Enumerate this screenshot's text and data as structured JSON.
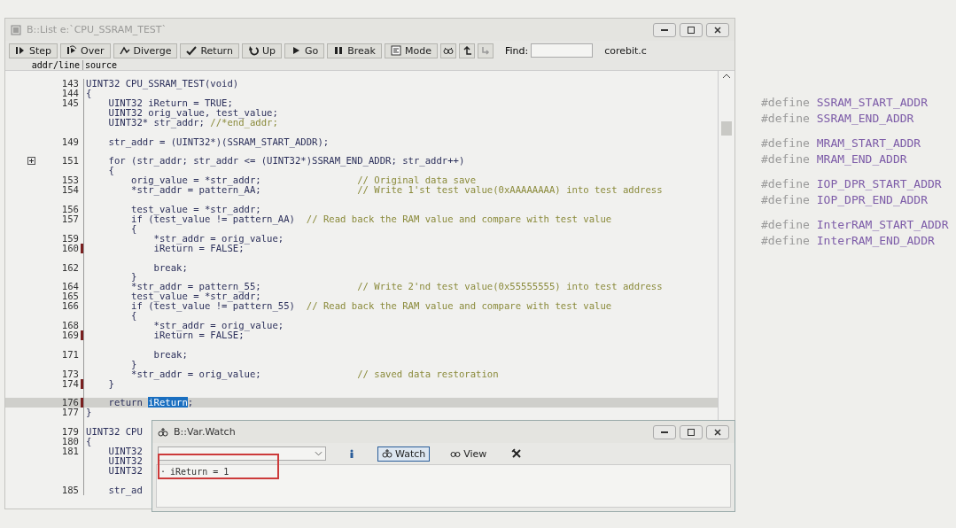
{
  "list_window": {
    "title": "B::List e:`CPU_SSRAM_TEST`",
    "toolbar": [
      {
        "kind": "step",
        "label": "Step"
      },
      {
        "kind": "over",
        "label": "Over"
      },
      {
        "kind": "diverge",
        "label": "Diverge"
      },
      {
        "kind": "return",
        "label": "Return"
      },
      {
        "kind": "up",
        "label": "Up"
      },
      {
        "kind": "go",
        "label": "Go"
      },
      {
        "kind": "break",
        "label": "Break"
      },
      {
        "kind": "mode",
        "label": "Mode"
      },
      {
        "kind": "glasses"
      },
      {
        "kind": "back"
      },
      {
        "kind": "forward"
      }
    ],
    "find": {
      "label": "Find:"
    },
    "file": "corebit.c",
    "columns": [
      "addr/line",
      "source"
    ],
    "rows": [
      {
        "line": "143",
        "code": "UINT32 CPU_SSRAM_TEST(void)",
        "marked": false,
        "current": false
      },
      {
        "line": "144",
        "code": "{",
        "marked": false,
        "current": false
      },
      {
        "line": "145",
        "code": "    UINT32 iReturn = TRUE;",
        "marked": false,
        "current": false
      },
      {
        "code": "    UINT32 orig_value, test_value;",
        "marked": false,
        "current": false
      },
      {
        "code": "    UINT32* str_addr;",
        "end_comment": "//*end_addr;",
        "marked": false,
        "current": false
      },
      {
        "marked": false,
        "current": false
      },
      {
        "line": "149",
        "code": "    str_addr = (UINT32*)(SSRAM_START_ADDR);",
        "marked": false,
        "current": false
      },
      {
        "marked": false,
        "current": false
      },
      {
        "line": "151",
        "code": "    for (str_addr; str_addr <= (UINT32*)SSRAM_END_ADDR; str_addr++)",
        "expandable": true,
        "marked": false,
        "current": false
      },
      {
        "code": "    {",
        "marked": false,
        "current": false
      },
      {
        "line": "153",
        "code": "        orig_value = *str_addr;",
        "comment": "// Original data save",
        "marked": false,
        "current": false
      },
      {
        "line": "154",
        "code": "        *str_addr = pattern_AA;",
        "comment": "// Write 1'st test value(0xAAAAAAAA) into test address",
        "marked": false,
        "current": false
      },
      {
        "marked": false,
        "current": false
      },
      {
        "line": "156",
        "code": "        test_value = *str_addr;",
        "marked": false,
        "current": false
      },
      {
        "line": "157",
        "code": "        if (test_value != pattern_AA)",
        "inline_comment": "// Read back the RAM value and compare with test value",
        "marked": false,
        "current": false
      },
      {
        "code": "        {",
        "marked": false,
        "current": false
      },
      {
        "line": "159",
        "code": "            *str_addr = orig_value;",
        "marked": false,
        "current": false
      },
      {
        "line": "160",
        "code": "            iReturn = FALSE;",
        "marked": true,
        "current": false
      },
      {
        "marked": false,
        "current": false
      },
      {
        "line": "162",
        "code": "            break;",
        "marked": false,
        "current": false
      },
      {
        "code": "        }",
        "marked": false,
        "current": false
      },
      {
        "line": "164",
        "code": "        *str_addr = pattern_55;",
        "comment": "// Write 2'nd test value(0x55555555) into test address",
        "marked": false,
        "current": false
      },
      {
        "line": "165",
        "code": "        test_value = *str_addr;",
        "marked": false,
        "current": false
      },
      {
        "line": "166",
        "code": "        if (test_value != pattern_55)",
        "inline_comment": "// Read back the RAM value and compare with test value",
        "marked": false,
        "current": false
      },
      {
        "code": "        {",
        "marked": false,
        "current": false
      },
      {
        "line": "168",
        "code": "            *str_addr = orig_value;",
        "marked": false,
        "current": false
      },
      {
        "line": "169",
        "code": "            iReturn = FALSE;",
        "marked": true,
        "current": false
      },
      {
        "marked": false,
        "current": false
      },
      {
        "line": "171",
        "code": "            break;",
        "marked": false,
        "current": false
      },
      {
        "code": "        }",
        "marked": false,
        "current": false
      },
      {
        "line": "173",
        "code": "        *str_addr = orig_value;",
        "comment": "// saved data restoration",
        "marked": false,
        "current": false
      },
      {
        "line": "174",
        "code": "    }",
        "marked": true,
        "current": false
      },
      {
        "marked": false,
        "current": false
      },
      {
        "line": "176",
        "code": "    return",
        "selection": "iReturn",
        "code_end": ";",
        "marked": true,
        "current": true
      },
      {
        "line": "177",
        "code": "}",
        "marked": false,
        "current": false
      },
      {
        "marked": false,
        "current": false
      },
      {
        "line": "179",
        "code": "UINT32 CPU",
        "marked": false,
        "current": false
      },
      {
        "line": "180",
        "code": "{",
        "marked": false,
        "current": false
      },
      {
        "line": "181",
        "code": "    UINT32",
        "marked": false,
        "current": false
      },
      {
        "code": "    UINT32",
        "marked": false,
        "current": false
      },
      {
        "code": "    UINT32",
        "marked": false,
        "current": false
      },
      {
        "marked": false,
        "current": false
      },
      {
        "line": "185",
        "code": "    str_ad",
        "marked": false,
        "current": false
      }
    ]
  },
  "watch_window": {
    "title": "B::Var.Watch",
    "toolbar": [
      {
        "kind": "info"
      },
      {
        "kind": "watch",
        "label": "Watch",
        "selected": true
      },
      {
        "kind": "view",
        "label": "View",
        "selected": false
      },
      {
        "kind": "tool"
      }
    ],
    "entries": [
      {
        "bullet": "·",
        "text": "iReturn = 1",
        "highlighted": true
      }
    ]
  },
  "define_groups": [
    {
      "defines": [
        {
          "keyword": "#define",
          "name": "SSRAM_START_ADDR"
        },
        {
          "keyword": "#define",
          "name": "SSRAM_END_ADDR"
        }
      ]
    },
    {
      "defines": [
        {
          "keyword": "#define",
          "name": "MRAM_START_ADDR"
        },
        {
          "keyword": "#define",
          "name": "MRAM_END_ADDR"
        }
      ]
    },
    {
      "defines": [
        {
          "keyword": "#define",
          "name": "IOP_DPR_START_ADDR"
        },
        {
          "keyword": "#define",
          "name": "IOP_DPR_END_ADDR"
        }
      ]
    },
    {
      "defines": [
        {
          "keyword": "#define",
          "name": "InterRAM_START_ADDR"
        },
        {
          "keyword": "#define",
          "name": "InterRAM_END_ADDR"
        }
      ]
    }
  ]
}
